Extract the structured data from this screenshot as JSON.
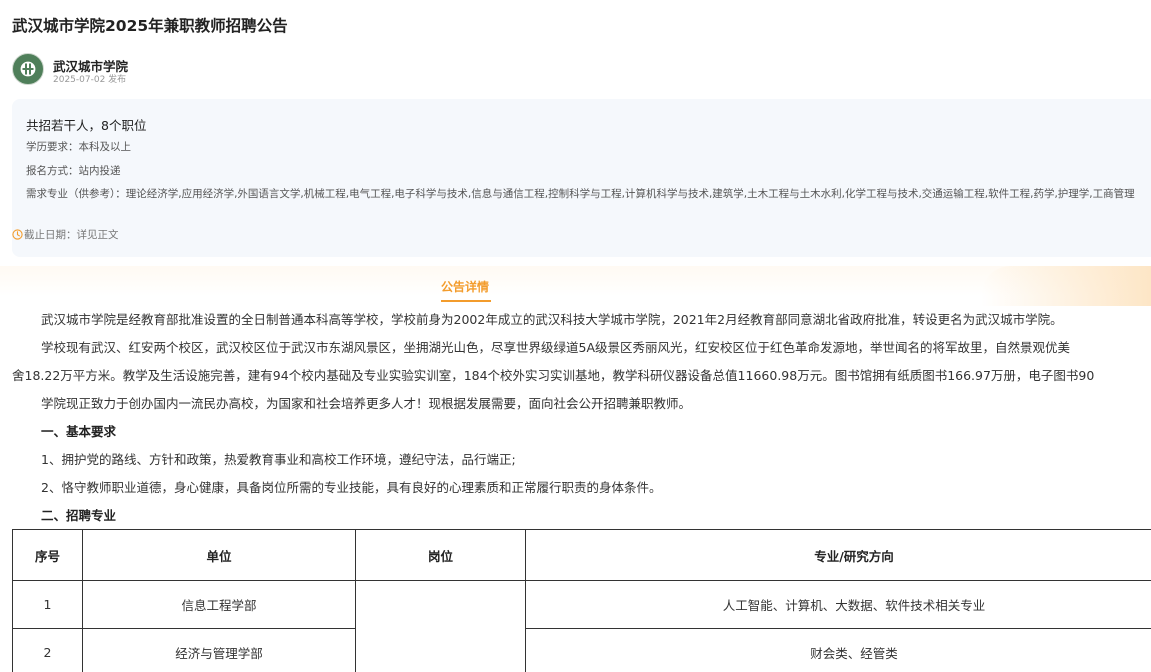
{
  "title": "武汉城市学院2025年兼职教师招聘公告",
  "publisher": {
    "name": "武汉城市学院",
    "date": "2025-07-02 发布"
  },
  "summary": {
    "main": "共招若干人，8个职位",
    "education": "学历要求：本科及以上",
    "apply": "报名方式：站内投递",
    "majors": "需求专业（供参考）：理论经济学,应用经济学,外国语言文学,机械工程,电气工程,电子科学与技术,信息与通信工程,控制科学与工程,计算机科学与技术,建筑学,土木工程与土木水利,化学工程与技术,交通运输工程,软件工程,药学,护理学,工商管理",
    "deadline": "截止日期：详见正文",
    "deadline_icon": "clock-icon"
  },
  "tab": {
    "label": "公告详情"
  },
  "content": {
    "p1": "武汉城市学院是经教育部批准设置的全日制普通本科高等学校，学校前身为2002年成立的武汉科技大学城市学院，2021年2月经教育部同意湖北省政府批准，转设更名为武汉城市学院。",
    "p2a": "学校现有武汉、红安两个校区，武汉校区位于武汉市东湖风景区，坐拥湖光山色，尽享世界级绿道5A级景区秀丽风光，红安校区位于红色革命发源地，举世闻名的将军故里，自然景观优美",
    "p2b": "舍18.22万平方米。教学及生活设施完善，建有94个校内基础及专业实验实训室，184个校外实习实训基地，教学科研仪器设备总值11660.98万元。图书馆拥有纸质图书166.97万册，电子图书90",
    "p3": "学院现正致力于创办国内一流民办高校，为国家和社会培养更多人才！现根据发展需要，面向社会公开招聘兼职教师。",
    "h1": "一、基本要求",
    "r1": "1、拥护党的路线、方针和政策，热爱教育事业和高校工作环境，遵纪守法，品行端正;",
    "r2": "2、恪守教师职业道德，身心健康，具备岗位所需的专业技能，具有良好的心理素质和正常履行职责的身体条件。",
    "h2": "二、招聘专业"
  },
  "table": {
    "headers": [
      "序号",
      "单位",
      "岗位",
      "专业/研究方向"
    ],
    "rows": [
      {
        "no": "1",
        "unit": "信息工程学部",
        "post": "",
        "major": "人工智能、计算机、大数据、软件技术相关专业"
      },
      {
        "no": "2",
        "unit": "经济与管理学部",
        "post": "",
        "major": "财会类、经管类"
      }
    ]
  },
  "colors": {
    "accent": "#f39c2c",
    "summary_bg": "#f5f8fc",
    "logo_green": "#4f7f5a"
  }
}
